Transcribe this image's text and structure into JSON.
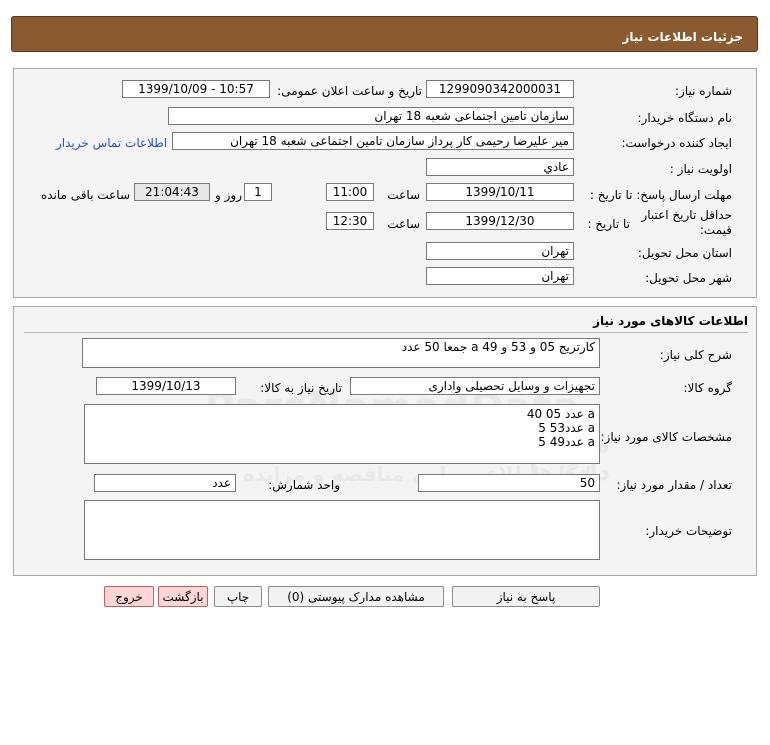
{
  "header": {
    "title": "جزئیات اطلاعات نیاز"
  },
  "info": {
    "need_number_label": "شماره نیاز:",
    "need_number": "1299090342000031",
    "announce_label": "تاریخ و ساعت اعلان عمومی:",
    "announce_value": "1399/10/09 - 10:57",
    "buyer_org_label": "نام دستگاه خریدار:",
    "buyer_org": "سازمان تامین اجتماعی شعبه 18 تهران",
    "requester_label": "ایجاد کننده درخواست:",
    "requester": "میر علیرضا رحیمی کار پرداز سازمان تامین اجتماعی شعبه 18 تهران",
    "contact_link": "اطلاعات تماس خریدار",
    "priority_label": "اولویت نیاز :",
    "priority": "عادي",
    "deadline_label": "مهلت ارسال پاسخ: تا تاریخ :",
    "deadline_date": "1399/10/11",
    "time_label": "ساعت",
    "deadline_time": "11:00",
    "days_value": "1",
    "days_label": "روز و",
    "remaining_value": "21:04:43",
    "remaining_label": "ساعت باقی مانده",
    "validity_label": "حداقل تاریخ اعتبار قیمت:",
    "validity_to_label": "تا تاریخ :",
    "validity_date": "1399/12/30",
    "validity_time_label": "ساعت",
    "validity_time": "12:30",
    "province_label": "استان محل تحویل:",
    "province": "تهران",
    "city_label": "شهر محل تحویل:",
    "city": "تهران"
  },
  "goods": {
    "section_title": "اطلاعات کالاهای مورد نیاز",
    "desc_label": "شرح کلی نیاز:",
    "desc": "کارتریج 05 و 53 و 49 a    جمعا 50 عدد",
    "group_label": "گروه کالا:",
    "group": "تجهیزات و وسایل تحصیلی واداری",
    "need_date_label": "تاریخ نیاز به کالا:",
    "need_date": "1399/10/13",
    "specs_label": "مشخصات کالای مورد نیاز:",
    "specs": "40 عدد 05 a\n5 عدد53 a\n5 عدد49 a",
    "qty_label": "تعداد / مقدار مورد نیاز:",
    "qty": "50",
    "unit_label": "واحد شمارش:",
    "unit": "عدد",
    "buyer_notes_label": "توضیحات خریدار:",
    "buyer_notes": ""
  },
  "buttons": {
    "reply": "پاسخ به نیاز",
    "attachments": "مشاهده مدارک پیوستی (0)",
    "print": "چاپ",
    "back": "بازگشت",
    "exit": "خروج"
  },
  "watermark": {
    "brand": "ParsNamadData",
    "line1": "مرکز فرآوری اطلاعات پارس نماد داده ها",
    "line2": "پایگاه اطلاع رسانی مناقصه و مزایده",
    "phone": "۰۲۱-۸۸۳۴۹۶۷۰-۵"
  }
}
